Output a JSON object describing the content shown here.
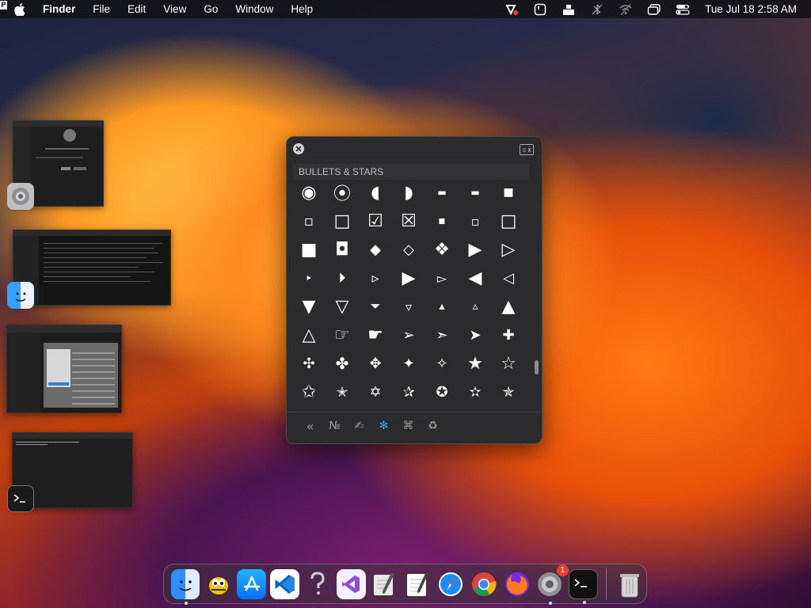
{
  "menubar": {
    "app_name": "Finder",
    "menus": [
      "File",
      "Edit",
      "View",
      "Go",
      "Window",
      "Help"
    ],
    "clock": "Tue Jul 18  2:58 AM",
    "input_indicator": "P"
  },
  "character_viewer": {
    "category_title": "BULLETS & STARS",
    "symbols": [
      "◉",
      "⦿",
      "◖",
      "◗",
      "▬",
      "▬",
      "■",
      "▫",
      "□",
      "☑",
      "☒",
      "▪",
      "▫",
      "□",
      "■",
      "◘",
      "◆",
      "◇",
      "❖",
      "▶",
      "▷",
      "‣",
      "⏵",
      "▹",
      "▶",
      "▻",
      "◀",
      "◁",
      "▼",
      "▽",
      "⏷",
      "▿",
      "▴",
      "▵",
      "▲",
      "△",
      "☞",
      "☛",
      "➢",
      "➣",
      "➤",
      "✚",
      "✣",
      "✤",
      "✥",
      "✦",
      "✧",
      "★",
      "☆",
      "✩",
      "✭",
      "✡",
      "✰",
      "✪",
      "✫",
      "✯"
    ],
    "categories": [
      {
        "icon": "«",
        "name": "chevron-left"
      },
      {
        "icon": "№",
        "name": "letterlike"
      },
      {
        "icon": "✍",
        "name": "pictographs"
      },
      {
        "icon": "✻",
        "name": "bullets-stars"
      },
      {
        "icon": "⌘",
        "name": "technical"
      },
      {
        "icon": "♻",
        "name": "signs"
      }
    ]
  },
  "dock": {
    "apps": [
      {
        "name": "finder",
        "running": true
      },
      {
        "name": "cyberduck",
        "running": false
      },
      {
        "name": "app-store",
        "running": false
      },
      {
        "name": "vscode",
        "running": false
      },
      {
        "name": "help-viewer",
        "running": false
      },
      {
        "name": "visual-studio",
        "running": false
      },
      {
        "name": "script-editor",
        "running": false
      },
      {
        "name": "textedit",
        "running": false
      },
      {
        "name": "safari",
        "running": false
      },
      {
        "name": "chrome",
        "running": false
      },
      {
        "name": "firefox",
        "running": false
      },
      {
        "name": "system-settings",
        "running": true,
        "badge": "1"
      },
      {
        "name": "terminal",
        "running": true
      }
    ],
    "trash": "trash"
  }
}
